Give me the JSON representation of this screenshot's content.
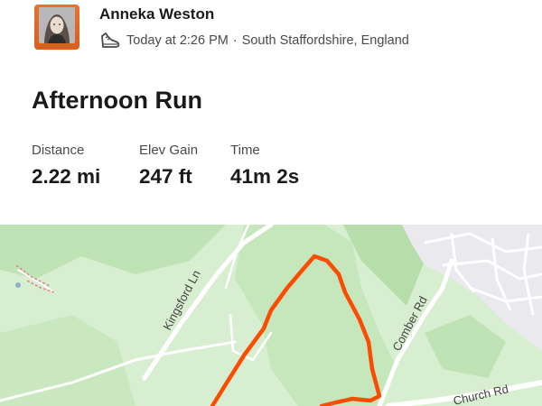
{
  "athlete": {
    "name": "Anneka Weston",
    "date_time": "Today at 2:26 PM",
    "separator": "·",
    "location": "South Staffordshire, England",
    "avatar_accent": "#e86a25"
  },
  "activity": {
    "title": "Afternoon Run",
    "sport_icon": "shoe-icon"
  },
  "stats": [
    {
      "label": "Distance",
      "value": "2.22 mi"
    },
    {
      "label": "Elev Gain",
      "value": "247 ft"
    },
    {
      "label": "Time",
      "value": "41m 2s"
    }
  ],
  "map": {
    "roads": [
      "Kingsford Ln",
      "Comber Rd",
      "Church Rd"
    ],
    "route_color": "#fc4c02",
    "land_color": "#d7eed0",
    "woodland_color": "#b9e0ad",
    "urban_color": "#e9e9ee"
  }
}
